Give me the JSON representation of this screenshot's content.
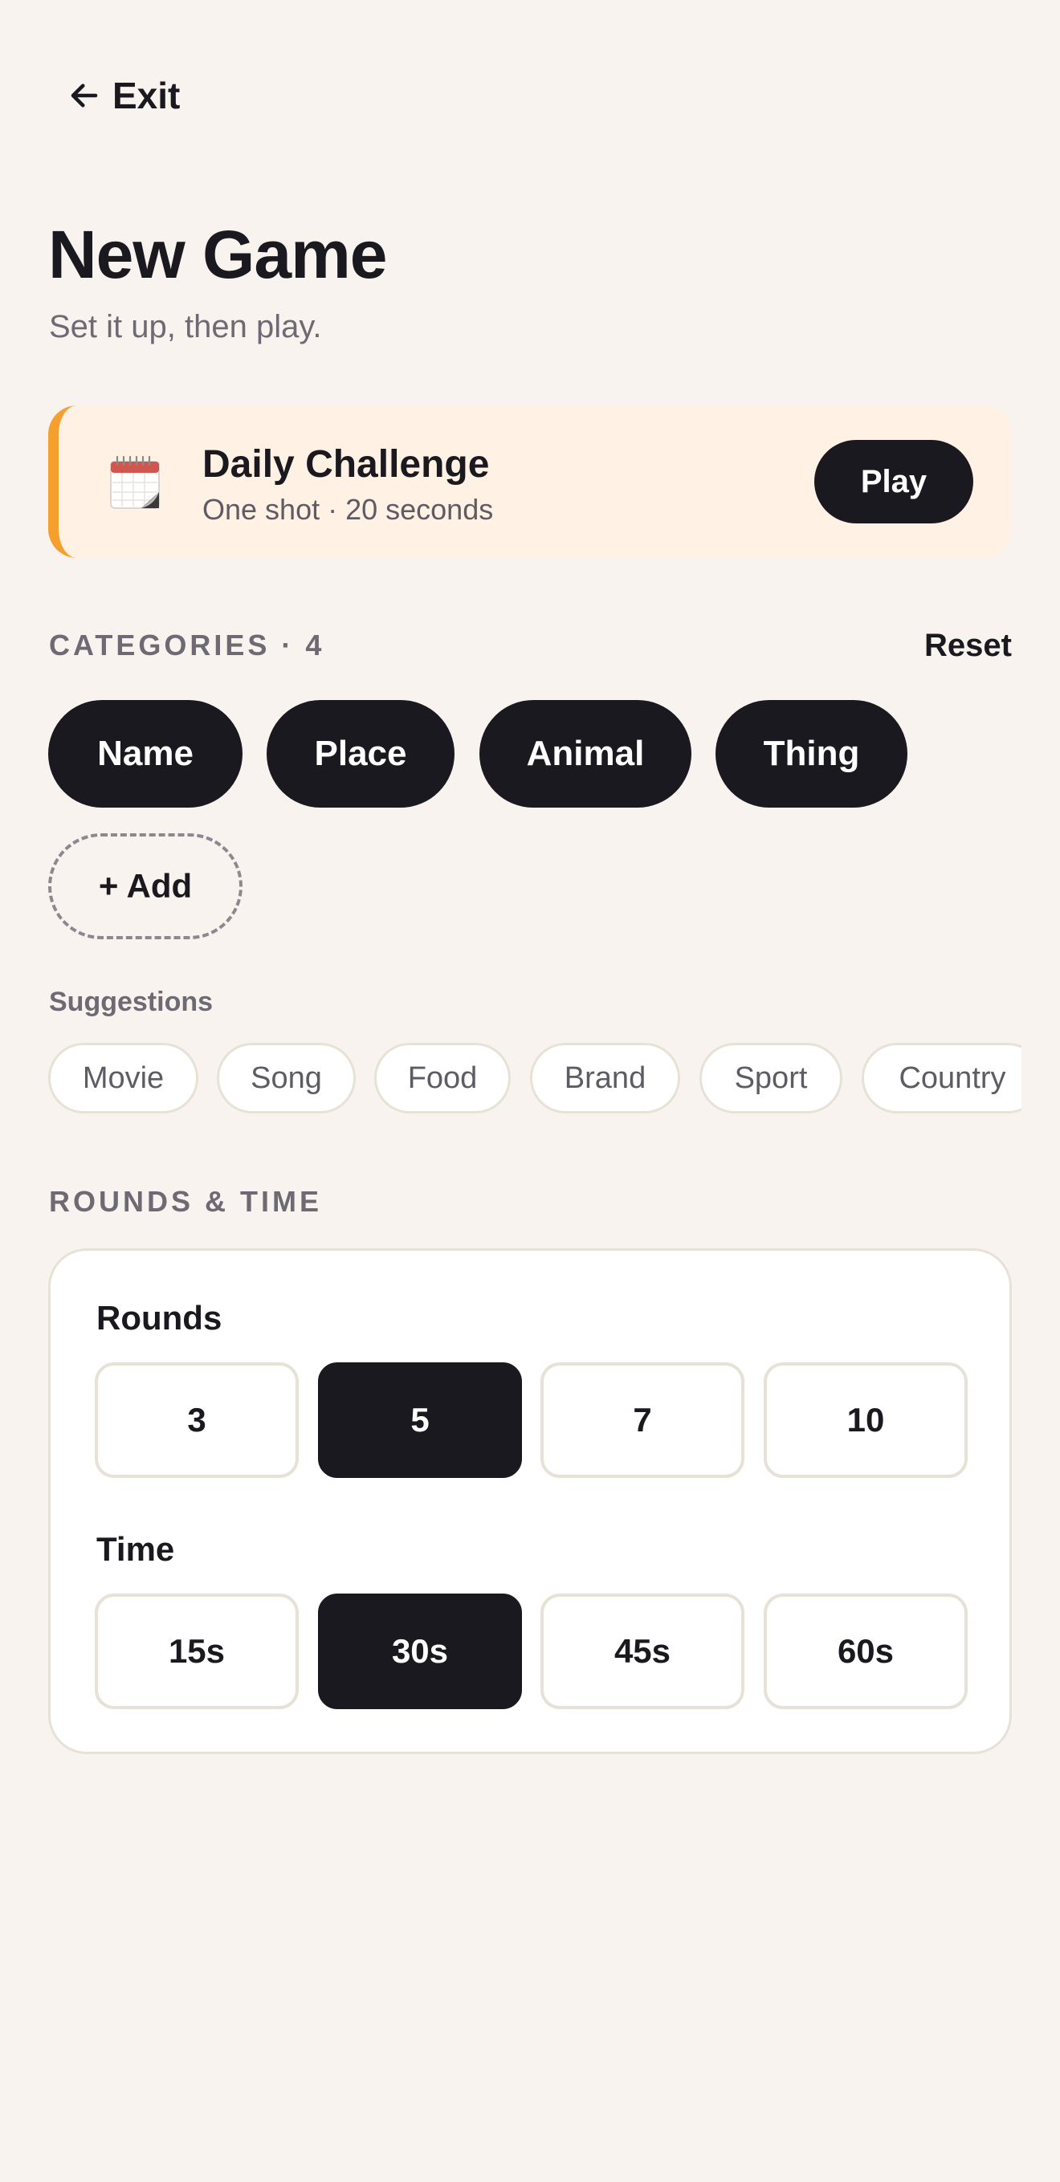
{
  "header": {
    "exit_label": "Exit",
    "title": "New Game",
    "subtitle": "Set it up, then play."
  },
  "daily_challenge": {
    "icon": "calendar-icon",
    "title": "Daily Challenge",
    "subtitle": "One shot · 20 seconds",
    "play_label": "Play",
    "accent_color": "#f5a02e"
  },
  "categories": {
    "label": "CATEGORIES · 4",
    "reset_label": "Reset",
    "items": [
      "Name",
      "Place",
      "Animal",
      "Thing"
    ],
    "add_label": "+ Add"
  },
  "suggestions": {
    "label": "Suggestions",
    "items": [
      "Movie",
      "Song",
      "Food",
      "Brand",
      "Sport",
      "Country"
    ]
  },
  "rounds_time": {
    "label": "ROUNDS & TIME",
    "rounds_label": "Rounds",
    "rounds_options": [
      "3",
      "5",
      "7",
      "10"
    ],
    "rounds_selected": "5",
    "time_label": "Time",
    "time_options": [
      "15s",
      "30s",
      "45s",
      "60s"
    ],
    "time_selected": "30s"
  },
  "colors": {
    "background": "#f8f3ee",
    "dark": "#1b1920",
    "muted": "#6e6a73"
  }
}
